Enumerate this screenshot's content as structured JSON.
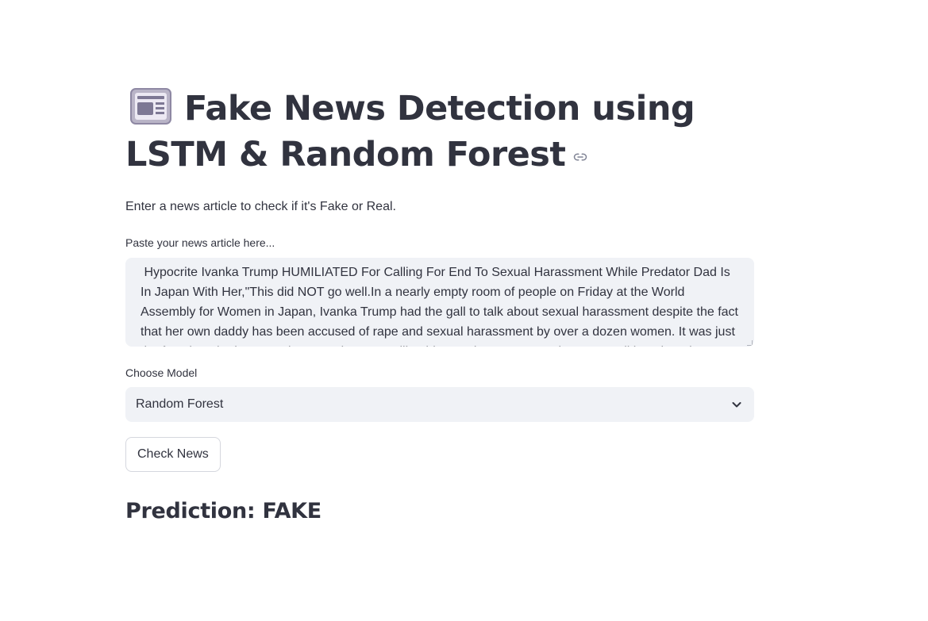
{
  "header": {
    "title_icon": "newspaper-icon",
    "title": "Fake News Detection using LSTM & Random Forest",
    "anchor_icon": "link-icon"
  },
  "intro": {
    "text": "Enter a news article to check if it's Fake or Real."
  },
  "article_input": {
    "label": "Paste your news article here...",
    "value": " Hypocrite Ivanka Trump HUMILIATED For Calling For End To Sexual Harassment While Predator Dad Is In Japan With Her,\"This did NOT go well.In a nearly empty room of people on Friday at the World Assembly for Women in Japan, Ivanka Trump had the gall to talk about sexual harassment despite the fact that her own daddy has been accused of rape and sexual harassment by over a dozen women. It was just the fact that she happened to attend an event like this at a time most Americans are talking about it."
  },
  "model_select": {
    "label": "Choose Model",
    "selected": "Random Forest",
    "icon": "chevron-down-icon"
  },
  "actions": {
    "check_label": "Check News"
  },
  "result": {
    "text": "Prediction: FAKE"
  },
  "colors": {
    "text": "#31333f",
    "input_bg": "#f0f2f6",
    "button_border": "#d5d7de"
  }
}
